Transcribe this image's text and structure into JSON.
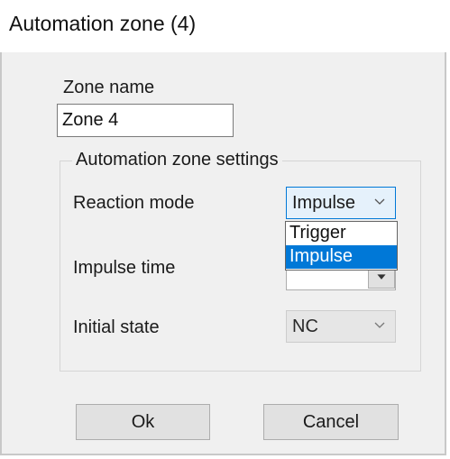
{
  "window": {
    "title": "Automation zone (4)"
  },
  "zone_name": {
    "label": "Zone name",
    "value": "Zone 4"
  },
  "settings_group": {
    "title": "Automation zone settings",
    "reaction_mode": {
      "label": "Reaction mode",
      "selected": "Impulse",
      "options": [
        "Trigger",
        "Impulse"
      ],
      "highlighted_option": "Impulse"
    },
    "impulse_time": {
      "label": "Impulse time"
    },
    "initial_state": {
      "label": "Initial state",
      "selected": "NC"
    }
  },
  "buttons": {
    "ok_label": "Ok",
    "cancel_label": "Cancel"
  },
  "colors": {
    "accent": "#0078d7",
    "dialog_bg": "#f0f0f0",
    "button_bg": "#e1e1e1"
  },
  "icons": {
    "combo_arrow": "chevron-down-icon"
  }
}
